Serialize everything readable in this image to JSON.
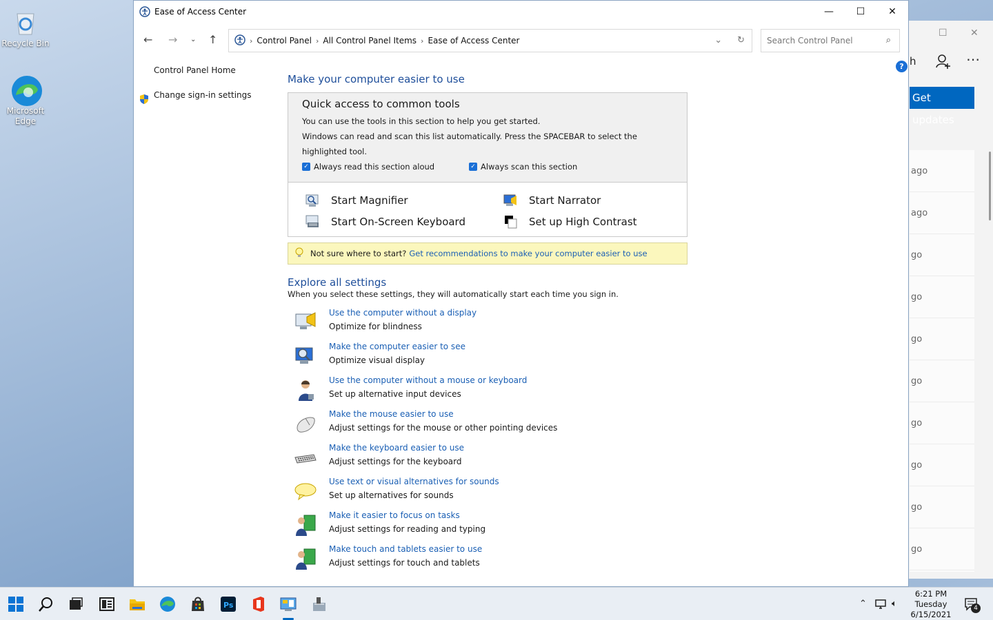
{
  "desktop": {
    "icons": [
      {
        "label": "Recycle Bin"
      },
      {
        "label": "Microsoft Edge"
      }
    ]
  },
  "background_window": {
    "partial_heading": "h",
    "update_button": "Get updates",
    "rows": [
      "ago",
      "ago",
      "go",
      "go",
      "go",
      "go",
      "go",
      "go",
      "go",
      "go"
    ]
  },
  "window": {
    "title": "Ease of Access Center",
    "breadcrumb": [
      "Control Panel",
      "All Control Panel Items",
      "Ease of Access Center"
    ],
    "search_placeholder": "Search Control Panel"
  },
  "sidebar": {
    "home": "Control Panel Home",
    "signin": "Change sign-in settings"
  },
  "main": {
    "heading": "Make your computer easier to use",
    "quick": {
      "title": "Quick access to common tools",
      "line1": "You can use the tools in this section to help you get started.",
      "line2": "Windows can read and scan this list automatically.  Press the SPACEBAR to select the highlighted tool.",
      "check1": "Always read this section aloud",
      "check2": "Always scan this section",
      "tools": [
        "Start Magnifier",
        "Start Narrator",
        "Start On-Screen Keyboard",
        "Set up High Contrast"
      ]
    },
    "tip": {
      "prefix": "Not sure where to start?",
      "link": "Get recommendations to make your computer easier to use"
    },
    "explore_title": "Explore all settings",
    "explore_sub": "When you select these settings, they will automatically start each time you sign in.",
    "settings": [
      {
        "link": "Use the computer without a display",
        "desc": "Optimize for blindness",
        "icon": "monitor-speaker-icon"
      },
      {
        "link": "Make the computer easier to see",
        "desc": "Optimize visual display",
        "icon": "monitor-magnifier-icon"
      },
      {
        "link": "Use the computer without a mouse or keyboard",
        "desc": "Set up alternative input devices",
        "icon": "person-icon"
      },
      {
        "link": "Make the mouse easier to use",
        "desc": "Adjust settings for the mouse or other pointing devices",
        "icon": "mouse-icon"
      },
      {
        "link": "Make the keyboard easier to use",
        "desc": "Adjust settings for the keyboard",
        "icon": "keyboard-icon"
      },
      {
        "link": "Use text or visual alternatives for sounds",
        "desc": "Set up alternatives for sounds",
        "icon": "speech-bubble-icon"
      },
      {
        "link": "Make it easier to focus on tasks",
        "desc": "Adjust settings for reading and typing",
        "icon": "users-icon"
      },
      {
        "link": "Make touch and tablets easier to use",
        "desc": "Adjust settings for touch and tablets",
        "icon": "users-tablet-icon"
      }
    ]
  },
  "taskbar": {
    "time": "6:21 PM",
    "day": "Tuesday",
    "date": "6/15/2021",
    "notifications": "4"
  }
}
